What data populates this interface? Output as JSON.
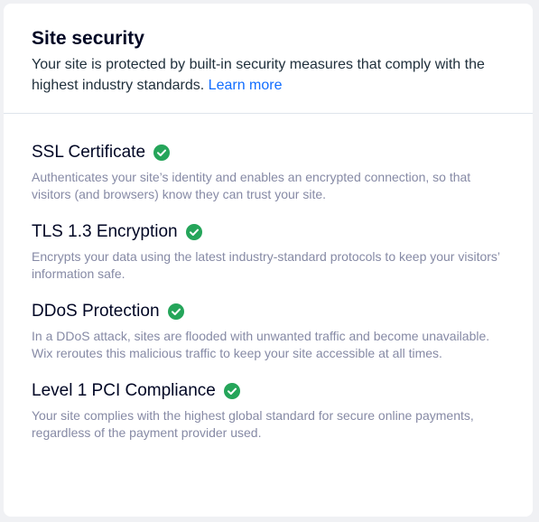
{
  "header": {
    "title": "Site security",
    "subtitle_text": "Your site is protected by built-in security measures that comply with the highest industry standards.",
    "learn_more_label": "Learn more"
  },
  "features": [
    {
      "title": "SSL Certificate",
      "description": "Authenticates your site’s identity and enables an encrypted connection, so that visitors (and browsers) know they can trust your site."
    },
    {
      "title": "TLS 1.3 Encryption",
      "description": "Encrypts your data using the latest industry-standard protocols to keep your visitors’ information safe."
    },
    {
      "title": "DDoS Protection",
      "description": "In a DDoS attack, sites are flooded with unwanted traffic and become unavailable. Wix reroutes this malicious traffic to keep your site accessible at all times."
    },
    {
      "title": "Level 1 PCI Compliance",
      "description": "Your site complies with the highest global standard for secure online payments, regardless of the payment provider used."
    }
  ],
  "icons": {
    "check": "check-circle-icon"
  },
  "colors": {
    "check_green": "#25a55a",
    "link_blue": "#116dff"
  }
}
